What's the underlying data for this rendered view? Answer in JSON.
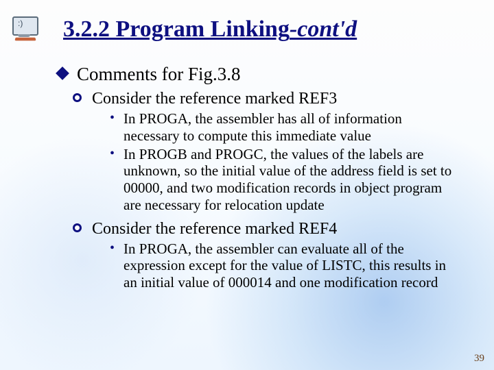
{
  "title": {
    "main": "3.2.2 Program Linking",
    "suffix": "-cont'd"
  },
  "level1": "Comments for Fig.3.8",
  "sections": [
    {
      "heading": "Consider the reference marked REF3",
      "bullets": [
        "In PROGA, the assembler has all of information necessary to compute this immediate value",
        "In PROGB and PROGC, the values of the labels are unknown, so the initial value of the address field is set to 00000, and two modification records in object program are necessary for relocation update"
      ]
    },
    {
      "heading": "Consider the reference marked REF4",
      "bullets": [
        "In PROGA, the assembler can evaluate all of the expression except for the value of LISTC, this results in an initial value of 000014 and one modification record"
      ]
    }
  ],
  "page_number": "39"
}
